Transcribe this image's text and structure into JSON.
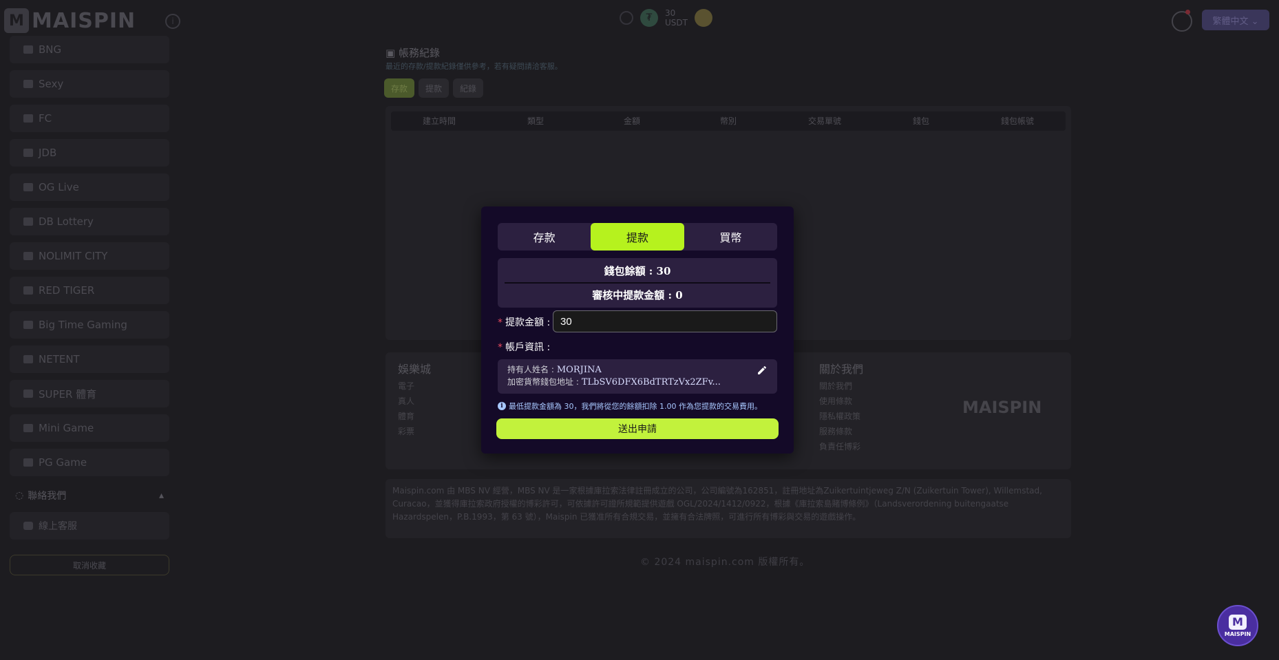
{
  "header": {
    "logo_letter": "M",
    "logo_text": "MAISPIN",
    "balance_amount": "30",
    "balance_currency": "USDT",
    "language_label": "繁體中文 ⌄"
  },
  "sidebar": {
    "items": [
      {
        "label": "BNG"
      },
      {
        "label": "Sexy"
      },
      {
        "label": "FC"
      },
      {
        "label": "JDB"
      },
      {
        "label": "OG Live"
      },
      {
        "label": "DB Lottery"
      },
      {
        "label": "NOLIMIT CITY"
      },
      {
        "label": "RED TIGER"
      },
      {
        "label": "Big Time Gaming"
      },
      {
        "label": "NETENT"
      },
      {
        "label": "SUPER 體育"
      },
      {
        "label": "Mini Game"
      },
      {
        "label": "PG Game"
      }
    ],
    "contact_section": "聯絡我們",
    "contact_item": "線上客服",
    "cancel_favorite": "取消收藏"
  },
  "records": {
    "title": "帳務紀錄",
    "subtitle": "最近的存款/提款紀錄僅供參考，若有疑問請洽客服。",
    "tabs": [
      "存款",
      "提款",
      "紀錄"
    ],
    "columns": [
      "建立時間",
      "類型",
      "金額",
      "幣別",
      "交易單號",
      "錢包",
      "錢包帳號"
    ]
  },
  "footer": {
    "col1": {
      "heading": "娛樂城",
      "items": [
        "電子",
        "真人",
        "體育",
        "彩票"
      ]
    },
    "col2": {
      "heading": "關於我們",
      "items": [
        "關於我們",
        "使用條款",
        "隱私權政策",
        "服務條款",
        "負責任博彩"
      ]
    },
    "logo_text": "MAISPIN",
    "legal": "Maispin.com 由 MBS NV 經營，MBS NV 是一家根據庫拉索法律註冊成立的公司，公司編號為162851，註冊地址為Zuikertuintjeweg Z/N (Zuikertuin Tower), Willemstad, Curacao，並獲得庫拉索政府授權的博彩許可，可依據許可證所規範提供遊戲 OGL/2024/1412/0922，根據《庫拉索島賭博條例》（Landsverordening buitengaatse Hazardspelen，P.B.1993，第 63 號），Maispin 已獲准所有合規交易，並擁有合法牌照，可進行所有博彩與交易的遊戲操作。",
    "copyright": "© 2024 maispin.com 版權所有。"
  },
  "float_button": {
    "letter": "M",
    "label": "MAISPIN"
  },
  "modal": {
    "tabs": [
      {
        "label": "存款",
        "active": false
      },
      {
        "label": "提款",
        "active": true
      },
      {
        "label": "買幣",
        "active": false
      }
    ],
    "wallet_balance": "錢包餘額 : 30",
    "pending_withdrawal": "審核中提款金額 : 0",
    "amount_label": "提款金額 :",
    "amount_value": "30",
    "account_label": "帳戶資訊 :",
    "holder_label": "持有人姓名 :",
    "holder_name": "MORJINA",
    "wallet_address_label": "加密貨幣錢包地址 :",
    "wallet_address": "TLbSV6DFX6BdTRTzVx2ZFv...",
    "notice": "最低提款金額為 30，我們將從您的餘額扣除 1.00 作為您提款的交易費用。",
    "submit_label": "送出申請",
    "colors": {
      "accent": "#b6f21e",
      "panel": "#140a28",
      "box": "#2c2040"
    }
  }
}
